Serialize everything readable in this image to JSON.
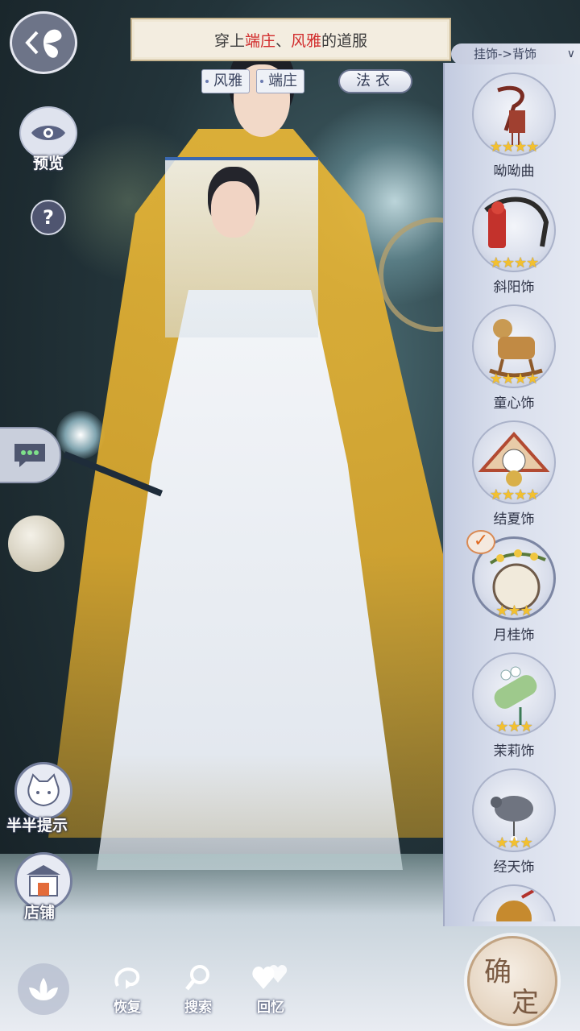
{
  "quest": {
    "prefix": "穿上",
    "kw1": "端庄",
    "sep": "、",
    "kw2": "风雅",
    "suffix": "的道服"
  },
  "tags": [
    "风雅",
    "端庄"
  ],
  "fayi_tag": "法衣",
  "category": "挂饰->背饰",
  "preview_label": "预览",
  "help_label": "?",
  "items": [
    {
      "name": "呦呦曲",
      "stars": "★★★★",
      "selected": false,
      "icon": "tassel-hairpin-icon"
    },
    {
      "name": "斜阳饰",
      "stars": "★★★★",
      "selected": false,
      "icon": "red-comb-icon"
    },
    {
      "name": "童心饰",
      "stars": "★★★★",
      "selected": false,
      "icon": "rocking-horse-icon"
    },
    {
      "name": "结夏饰",
      "stars": "★★★★",
      "selected": false,
      "icon": "lucky-cat-fan-icon"
    },
    {
      "name": "月桂饰",
      "stars": "★★★",
      "selected": true,
      "icon": "osmanthus-moon-icon"
    },
    {
      "name": "茉莉饰",
      "stars": "★★★",
      "selected": false,
      "icon": "jasmine-scroll-icon"
    },
    {
      "name": "经天饰",
      "stars": "★★★",
      "selected": false,
      "icon": "turtle-ornament-icon"
    },
    {
      "name": "",
      "stars": "",
      "selected": false,
      "icon": "gourd-icon"
    }
  ],
  "hint_label": "半半提示",
  "shop_label": "店铺",
  "bottom": {
    "restore": "恢复",
    "search": "搜索",
    "memory": "回忆"
  },
  "confirm": {
    "c1": "确",
    "c2": "定"
  },
  "colors": {
    "accent_red": "#d12b2b",
    "star": "#f2c030",
    "panel": "#d8deec"
  }
}
